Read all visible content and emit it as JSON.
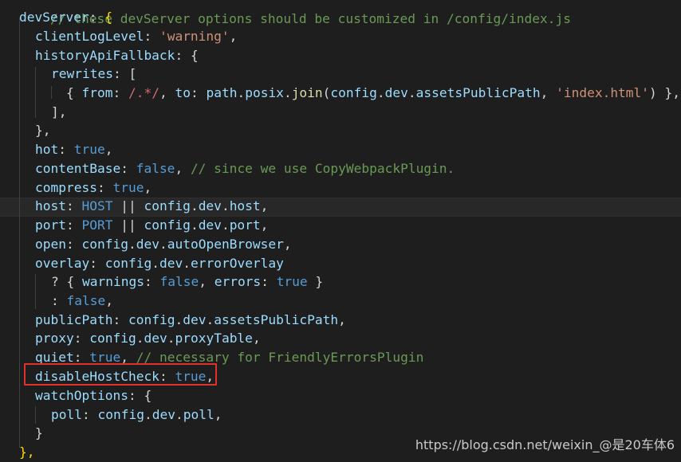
{
  "editor": {
    "top_comment": "// these devServer options should be customized in /config/index.js",
    "lines": {
      "devServer": {
        "key": "devServer",
        "colon": ": ",
        "brace": "{"
      },
      "clientLogLevel": {
        "key": "clientLogLevel",
        "colon": ": ",
        "value": "'warning'",
        "end": ","
      },
      "historyApiFallback": {
        "key": "historyApiFallback",
        "colon": ": ",
        "brace": "{"
      },
      "rewrites": {
        "key": "rewrites",
        "colon": ": ",
        "bracket": "["
      },
      "rewrite_entry": {
        "open": "{ ",
        "from_key": "from",
        "colon1": ": ",
        "from_value": "/.*/",
        "comma1": ", ",
        "to_key": "to",
        "colon2": ": ",
        "obj": "path",
        "dot1": ".",
        "prop": "posix",
        "dot2": ".",
        "fn": "join",
        "paren_open": "(",
        "cfg": "config",
        "dot3": ".",
        "dev": "dev",
        "dot4": ".",
        "apath": "assetsPublicPath",
        "comma2": ", ",
        "str": "'index.html'",
        "paren_close": ")",
        "close": " },"
      },
      "rewrites_close": "],",
      "history_close": "},",
      "hot": {
        "key": "hot",
        "colon": ": ",
        "value": "true",
        "end": ","
      },
      "contentBase": {
        "key": "contentBase",
        "colon": ": ",
        "value": "false",
        "end": ", ",
        "comment": "// since we use CopyWebpackPlugin."
      },
      "compress": {
        "key": "compress",
        "colon": ": ",
        "value": "true",
        "end": ","
      },
      "host": {
        "key": "host",
        "colon": ": ",
        "const": "HOST",
        "op": " || ",
        "path": [
          "config",
          "dev",
          "host"
        ],
        "end": ","
      },
      "port": {
        "key": "port",
        "colon": ": ",
        "const": "PORT",
        "op": " || ",
        "path": [
          "config",
          "dev",
          "port"
        ],
        "end": ","
      },
      "open": {
        "key": "open",
        "colon": ": ",
        "path": [
          "config",
          "dev",
          "autoOpenBrowser"
        ],
        "end": ","
      },
      "overlay": {
        "key": "overlay",
        "colon": ": ",
        "path": [
          "config",
          "dev",
          "errorOverlay"
        ]
      },
      "overlay_true": {
        "q": "? ",
        "open": "{ ",
        "warn_key": "warnings",
        "colon1": ": ",
        "warn_val": "false",
        "comma": ", ",
        "err_key": "errors",
        "colon2": ": ",
        "err_val": "true",
        "close": " }"
      },
      "overlay_false": {
        "c": ": ",
        "value": "false",
        "end": ","
      },
      "publicPath": {
        "key": "publicPath",
        "colon": ": ",
        "path": [
          "config",
          "dev",
          "assetsPublicPath"
        ],
        "end": ","
      },
      "proxy": {
        "key": "proxy",
        "colon": ": ",
        "path": [
          "config",
          "dev",
          "proxyTable"
        ],
        "end": ","
      },
      "quiet": {
        "key": "quiet",
        "colon": ": ",
        "value": "true",
        "end": ", ",
        "comment": "// necessary for FriendlyErrorsPlugin"
      },
      "disableHostCheck": {
        "key": "disableHostCheck",
        "colon": ": ",
        "value": "true",
        "end": ","
      },
      "watchOptions": {
        "key": "watchOptions",
        "colon": ": ",
        "brace": "{"
      },
      "poll": {
        "key": "poll",
        "colon": ": ",
        "path": [
          "config",
          "dev",
          "poll"
        ],
        "end": ","
      },
      "watch_close": "}",
      "devServer_close": "},"
    }
  },
  "colors": {
    "background": "#1e1e1e",
    "property": "#9cdcfe",
    "keyword": "#569cd6",
    "string": "#ce9178",
    "comment": "#6a9955",
    "function": "#dcdcaa",
    "highlight_box": "#e0312c"
  },
  "watermark": "https://blog.csdn.net/weixin_@是20车体6"
}
